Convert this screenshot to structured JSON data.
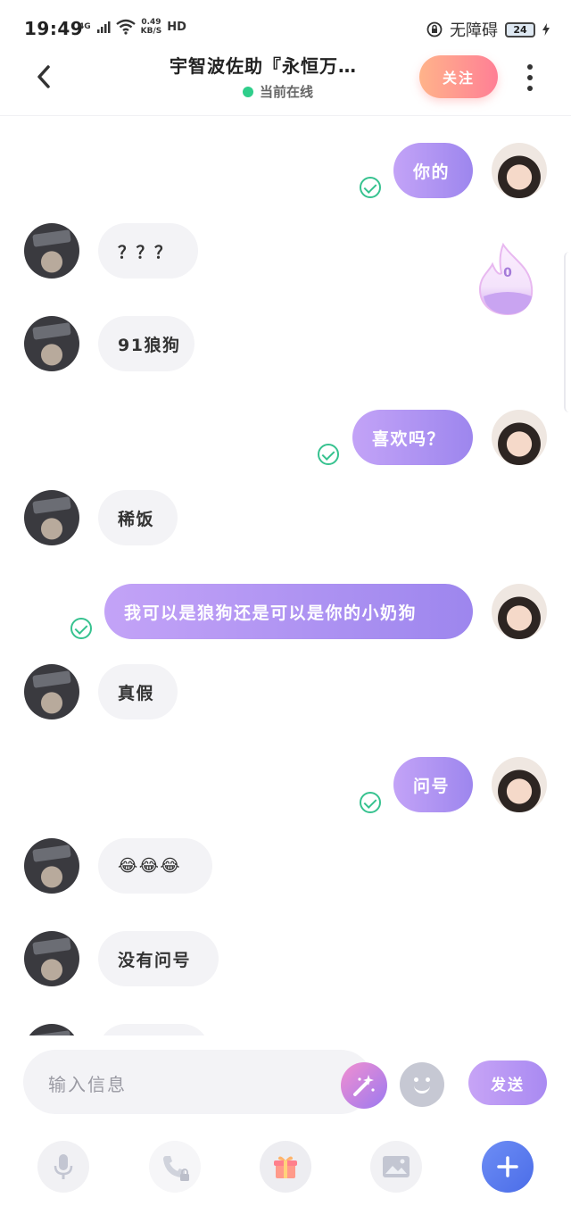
{
  "status_bar": {
    "time": "19:49",
    "network": "4G",
    "speed_value": "0.49",
    "speed_unit": "KB/S",
    "hd": "HD",
    "accessibility": "无障碍",
    "battery": "24"
  },
  "header": {
    "title": "宇智波佐助『永恒万…",
    "status": "当前在线",
    "follow_label": "关注"
  },
  "messages": [
    {
      "side": "out",
      "text": "你的"
    },
    {
      "side": "in",
      "text": "？？？"
    },
    {
      "side": "in",
      "text": "91狼狗"
    },
    {
      "side": "out",
      "text": "喜欢吗？"
    },
    {
      "side": "in",
      "text": "稀饭"
    },
    {
      "side": "out",
      "text": "我可以是狼狗还是可以是你的小奶狗"
    },
    {
      "side": "in",
      "text": "真假"
    },
    {
      "side": "out",
      "text": "问号"
    },
    {
      "side": "in",
      "text": "😂😂😂"
    },
    {
      "side": "in",
      "text": "没有问号"
    }
  ],
  "intimacy": {
    "value": "0"
  },
  "input": {
    "placeholder": "输入信息",
    "send_label": "发送"
  },
  "toolbar": {
    "icons": [
      "microphone-icon",
      "phone-icon",
      "gift-icon",
      "image-icon",
      "plus-icon"
    ]
  },
  "colors": {
    "accent": "#9d86ee",
    "online": "#2fce8b",
    "follow": "#ff8f93",
    "check": "#36c28f"
  }
}
